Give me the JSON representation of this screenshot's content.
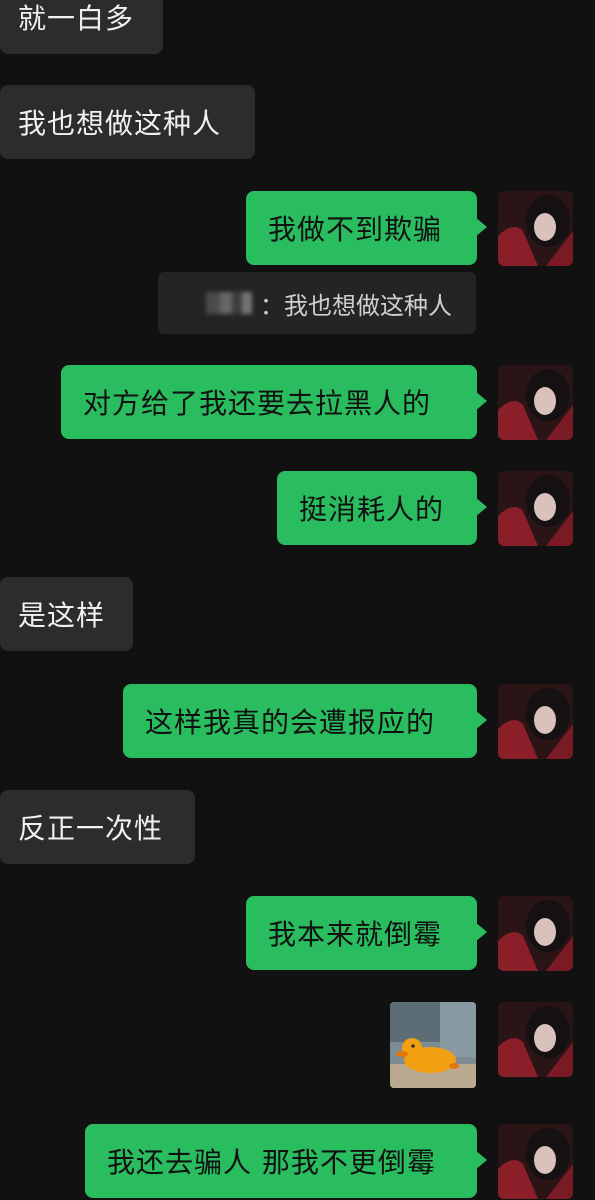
{
  "messages": [
    {
      "side": "left",
      "text": "就一白多"
    },
    {
      "side": "left",
      "text": "我也想做这种人"
    },
    {
      "side": "right",
      "text": "我做不到欺骗"
    },
    {
      "side": "quote",
      "text": "：我也想做这种人"
    },
    {
      "side": "right",
      "text": "对方给了我还要去拉黑人的"
    },
    {
      "side": "right",
      "text": "挺消耗人的"
    },
    {
      "side": "left",
      "text": "是这样"
    },
    {
      "side": "right",
      "text": "这样我真的会遭报应的"
    },
    {
      "side": "left",
      "text": "反正一次性"
    },
    {
      "side": "right",
      "text": "我本来就倒霉"
    },
    {
      "side": "right-sticker",
      "text": ""
    },
    {
      "side": "right",
      "text": "我还去骗人 那我不更倒霉"
    }
  ],
  "colors": {
    "background": "#111111",
    "incoming_bubble": "#2c2c2c",
    "outgoing_bubble": "#29bd5f"
  }
}
